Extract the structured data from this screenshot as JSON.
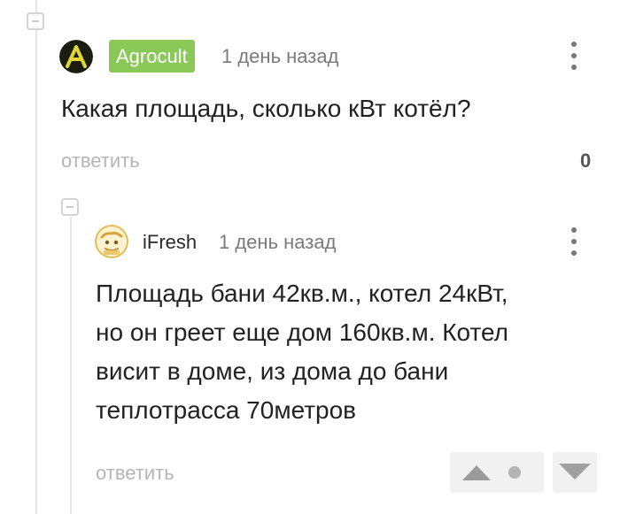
{
  "comment_1": {
    "author": "Agrocult",
    "time": "1 день назад",
    "text": "Какая площадь, сколько кВт котёл?",
    "reply_label": "ответить",
    "rating": "0",
    "avatar_letter": "A",
    "badge_color": "#8ac858"
  },
  "comment_2": {
    "author": "iFresh",
    "time": "1 день назад",
    "text_lines": [
      "Площадь бани 42кв.м., котел 24кВт,",
      "но он греет еще дом 160кв.м. Котел",
      "висит в доме, из дома до бани",
      "теплотрасса 70метров"
    ],
    "reply_label": "ответить"
  },
  "icons": {
    "collapse": "minus-square-icon",
    "menu": "more-vertical-icon",
    "upvote": "triangle-up-icon",
    "downvote": "triangle-down-icon"
  }
}
